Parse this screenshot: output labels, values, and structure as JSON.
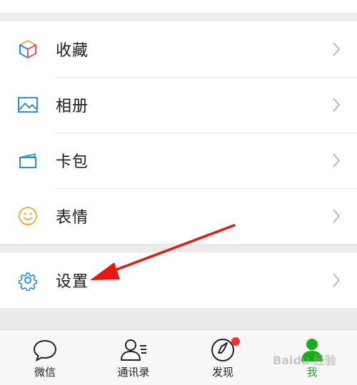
{
  "menu": {
    "items": [
      {
        "label": "收藏",
        "icon": "favorites-cube-icon"
      },
      {
        "label": "相册",
        "icon": "album-picture-icon"
      },
      {
        "label": "卡包",
        "icon": "card-wallet-icon"
      },
      {
        "label": "表情",
        "icon": "smiley-face-icon"
      }
    ],
    "settings": {
      "label": "设置",
      "icon": "gear-icon"
    }
  },
  "tabbar": {
    "tabs": [
      {
        "label": "微信",
        "icon": "chat-bubble-icon"
      },
      {
        "label": "通讯录",
        "icon": "contacts-icon"
      },
      {
        "label": "发现",
        "icon": "compass-icon"
      },
      {
        "label": "我",
        "icon": "me-person-icon"
      }
    ]
  },
  "watermark": "Baidu 经验",
  "colors": {
    "accent": "#1aad19",
    "icon_blue": "#2b8de8",
    "icon_orange": "#f7a94b",
    "annotation_arrow": "#e8170f",
    "badge_red": "#f43530"
  }
}
